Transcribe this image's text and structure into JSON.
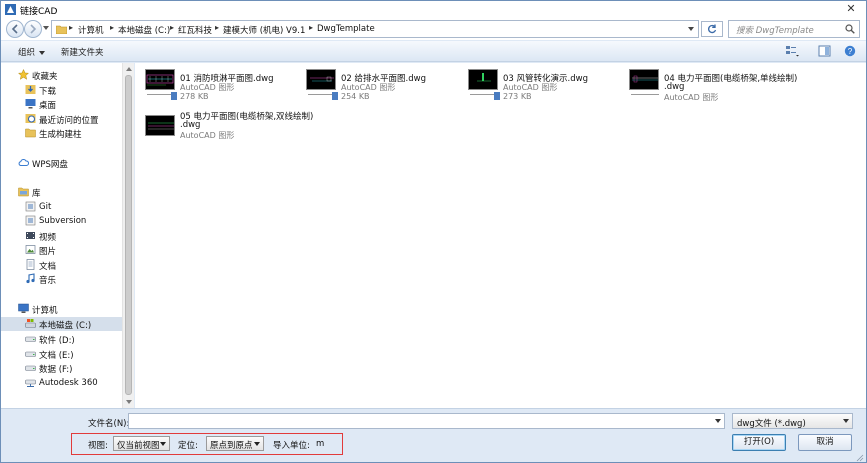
{
  "window": {
    "title": "链接CAD",
    "close_glyph": "✕"
  },
  "address": {
    "crumbs": [
      "计算机",
      "本地磁盘 (C:)",
      "红瓦科技",
      "建模大师 (机电) V9.1",
      "DwgTemplate"
    ],
    "search_placeholder": "搜索 DwgTemplate"
  },
  "toolbar": {
    "organize": "组织",
    "new_folder": "新建文件夹"
  },
  "sidebar": {
    "favorites": {
      "label": "收藏夹",
      "items": [
        "下载",
        "桌面",
        "最近访问的位置",
        "生成构建柱"
      ]
    },
    "wps": "WPS网盘",
    "libraries": {
      "label": "库",
      "items": [
        "Git",
        "Subversion",
        "视频",
        "图片",
        "文档",
        "音乐"
      ]
    },
    "computer": {
      "label": "计算机",
      "items": [
        "本地磁盘 (C:)",
        "软件 (D:)",
        "文档 (E:)",
        "数据 (F:)",
        "Autodesk 360"
      ]
    }
  },
  "files": [
    {
      "name": "01 消防喷淋平面图.dwg",
      "name2": "",
      "type": "AutoCAD 图形",
      "size": "278 KB"
    },
    {
      "name": "02 给排水平面图.dwg",
      "name2": "",
      "type": "AutoCAD 图形",
      "size": "254 KB"
    },
    {
      "name": "03 风管转化演示.dwg",
      "name2": "",
      "type": "AutoCAD 图形",
      "size": "273 KB"
    },
    {
      "name": "04 电力平面图(电缆桥架,单线绘制)",
      "name2": ".dwg",
      "type": "AutoCAD 图形",
      "size": ""
    },
    {
      "name": "05 电力平面图(电缆桥架,双线绘制)",
      "name2": ".dwg",
      "type": "AutoCAD 图形",
      "size": ""
    }
  ],
  "bottom": {
    "filename_label": "文件名(N):",
    "filename_value": "",
    "filter_value": "dwg文件 (*.dwg)",
    "view_label": "视图:",
    "view_value": "仅当前视图",
    "position_label": "定位:",
    "position_value": "原点到原点",
    "unit_label": "导入单位:",
    "unit_value": "m",
    "open_button": "打开(O)",
    "cancel_button": "取消"
  },
  "colors": {
    "highlight_box": "#e23b3b",
    "chrome": "#dfe9f5",
    "selected": "#d5dfeb"
  }
}
